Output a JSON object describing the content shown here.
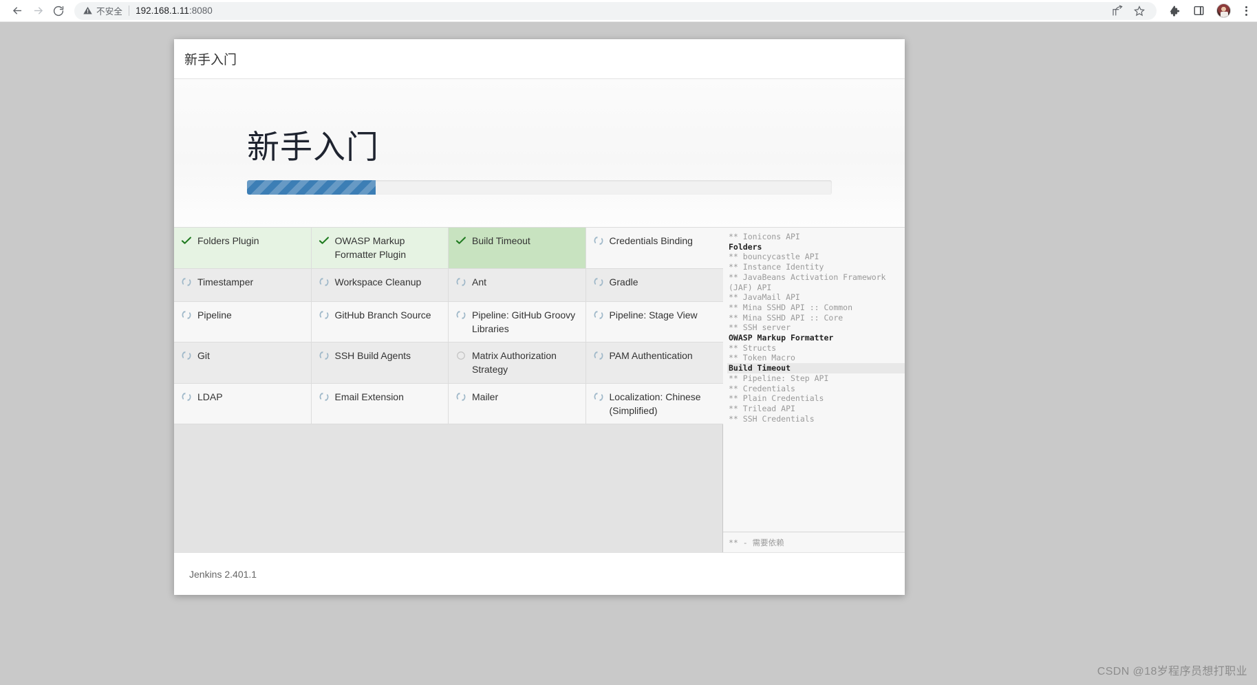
{
  "browser": {
    "back_icon": "arrow-left-icon",
    "forward_icon": "arrow-right-icon",
    "reload_icon": "reload-icon",
    "security_icon": "warning-triangle-icon",
    "security_label": "不安全",
    "url": "192.168.1.11",
    "port": ":8080",
    "share_icon": "share-icon",
    "bookmark_icon": "star-icon",
    "extensions_icon": "puzzle-piece-icon",
    "sidepanel_icon": "side-panel-icon",
    "profile_icon": "avatar",
    "menu_icon": "kebab-menu-icon"
  },
  "wizard": {
    "header_title": "新手入门",
    "hero_title": "新手入门",
    "progress_percent": 22,
    "footer_version": "Jenkins 2.401.1"
  },
  "plugins": [
    {
      "name": "Folders Plugin",
      "status": "success",
      "icon": "check-icon"
    },
    {
      "name": "OWASP Markup Formatter Plugin",
      "status": "success",
      "icon": "check-icon"
    },
    {
      "name": "Build Timeout",
      "status": "installing-highlight",
      "icon": "check-icon"
    },
    {
      "name": "Credentials Binding",
      "status": "pending-spinner",
      "icon": "spinner-icon"
    },
    {
      "name": "Timestamper",
      "status": "pending-spinner",
      "icon": "spinner-icon"
    },
    {
      "name": "Workspace Cleanup",
      "status": "pending-spinner",
      "icon": "spinner-icon"
    },
    {
      "name": "Ant",
      "status": "pending-spinner",
      "icon": "spinner-icon"
    },
    {
      "name": "Gradle",
      "status": "pending-spinner",
      "icon": "spinner-icon"
    },
    {
      "name": "Pipeline",
      "status": "pending-spinner",
      "icon": "spinner-icon"
    },
    {
      "name": "GitHub Branch Source",
      "status": "pending-spinner",
      "icon": "spinner-icon"
    },
    {
      "name": "Pipeline: GitHub Groovy Libraries",
      "status": "pending-spinner",
      "icon": "spinner-icon"
    },
    {
      "name": "Pipeline: Stage View",
      "status": "pending-spinner",
      "icon": "spinner-icon"
    },
    {
      "name": "Git",
      "status": "pending-spinner",
      "icon": "spinner-icon"
    },
    {
      "name": "SSH Build Agents",
      "status": "pending-spinner",
      "icon": "spinner-icon"
    },
    {
      "name": "Matrix Authorization Strategy",
      "status": "queued",
      "icon": "circle-outline-icon"
    },
    {
      "name": "PAM Authentication",
      "status": "pending-spinner",
      "icon": "spinner-icon"
    },
    {
      "name": "LDAP",
      "status": "pending-spinner",
      "icon": "spinner-icon"
    },
    {
      "name": "Email Extension",
      "status": "pending-spinner",
      "icon": "spinner-icon"
    },
    {
      "name": "Mailer",
      "status": "pending-spinner",
      "icon": "spinner-icon"
    },
    {
      "name": "Localization: Chinese (Simplified)",
      "status": "pending-spinner",
      "icon": "spinner-icon"
    }
  ],
  "log": {
    "lines": [
      {
        "text": "** Ionicons API",
        "kind": "dep"
      },
      {
        "text": "Folders",
        "kind": "main"
      },
      {
        "text": "** bouncycastle API",
        "kind": "dep"
      },
      {
        "text": "** Instance Identity",
        "kind": "dep"
      },
      {
        "text": "** JavaBeans Activation Framework",
        "kind": "dep"
      },
      {
        "text": "(JAF) API",
        "kind": "dep"
      },
      {
        "text": "** JavaMail API",
        "kind": "dep"
      },
      {
        "text": "** Mina SSHD API :: Common",
        "kind": "dep"
      },
      {
        "text": "** Mina SSHD API :: Core",
        "kind": "dep"
      },
      {
        "text": "** SSH server",
        "kind": "dep"
      },
      {
        "text": "OWASP Markup Formatter",
        "kind": "main"
      },
      {
        "text": "** Structs",
        "kind": "dep"
      },
      {
        "text": "** Token Macro",
        "kind": "dep"
      },
      {
        "text": "Build Timeout",
        "kind": "main-active"
      },
      {
        "text": "** Pipeline: Step API",
        "kind": "dep"
      },
      {
        "text": "** Credentials",
        "kind": "dep"
      },
      {
        "text": "** Plain Credentials",
        "kind": "dep"
      },
      {
        "text": "** Trilead API",
        "kind": "dep"
      },
      {
        "text": "** SSH Credentials",
        "kind": "dep"
      }
    ],
    "legend": "** - 需要依赖"
  },
  "watermark": "CSDN @18岁程序员想打职业",
  "colors": {
    "accent_blue": "#3c7eb5",
    "success_green": "#1f7a1f",
    "spinner_blue": "#9fb8c9",
    "success_bg": "#e6f3e3",
    "success_bg_highlight": "#c8e3c0"
  }
}
